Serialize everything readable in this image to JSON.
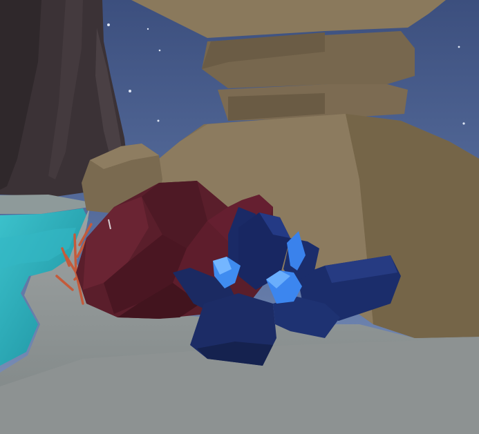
{
  "scene": {
    "kind": "3d-low-poly-game-viewport",
    "hud_text": [],
    "objects": [
      {
        "name": "night-sky",
        "color": "#4c6291"
      },
      {
        "name": "distant-cliff",
        "color": "#3a3135"
      },
      {
        "name": "ocean-water",
        "color": "#28a7b4"
      },
      {
        "name": "sandy-beach",
        "color": "#8b9191"
      },
      {
        "name": "mushroom-rock-pillar",
        "color": "#7f6f55"
      },
      {
        "name": "red-coral-rock",
        "color": "#5a1e2b"
      },
      {
        "name": "orange-branch-coral",
        "color": "#c45b3b"
      },
      {
        "name": "blue-crystal-cluster",
        "color": "#1b2d6b"
      },
      {
        "name": "crystal-highlight",
        "color": "#3f8cf0"
      }
    ]
  }
}
